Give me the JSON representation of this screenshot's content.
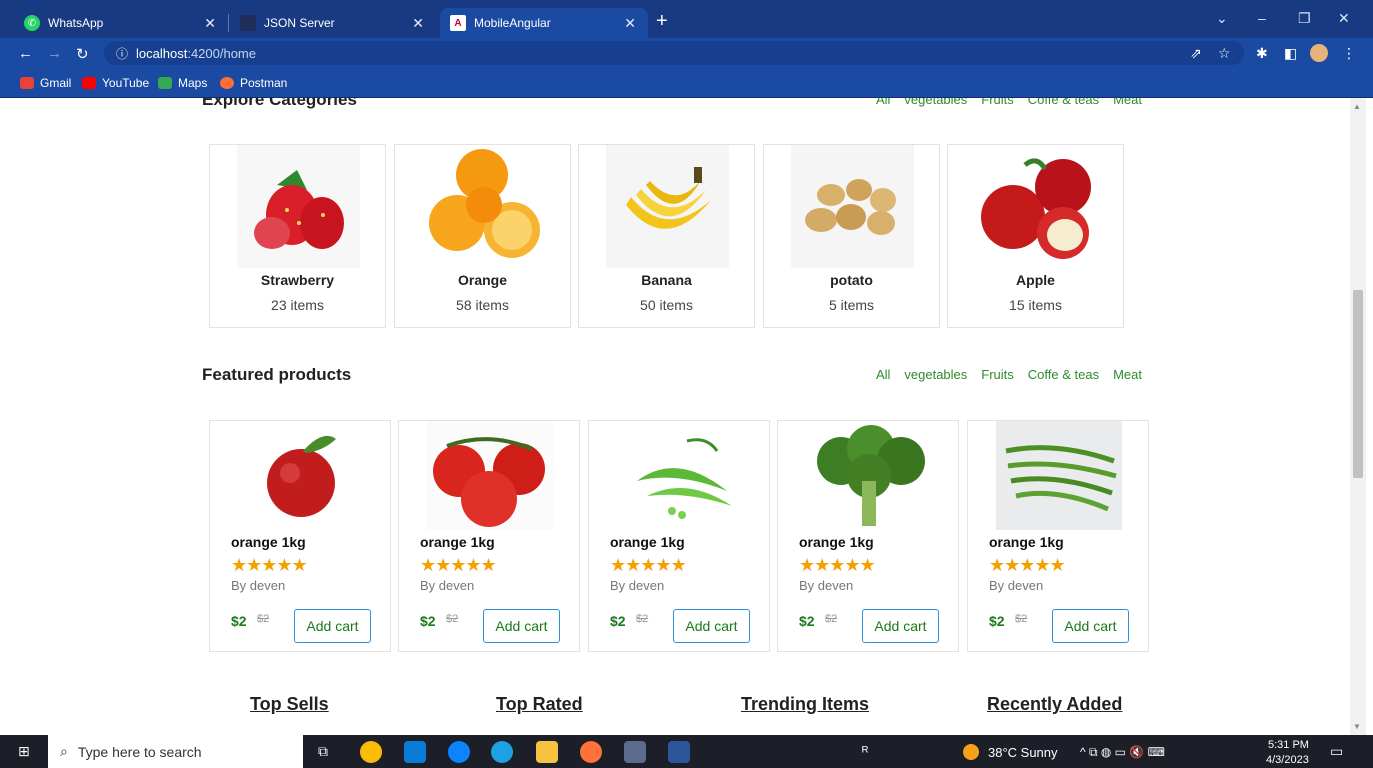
{
  "browser": {
    "tabs": [
      {
        "title": "WhatsApp",
        "active": false
      },
      {
        "title": "JSON Server",
        "active": false
      },
      {
        "title": "MobileAngular",
        "active": true
      }
    ],
    "url_host": "localhost",
    "url_rest": ":4200/home",
    "bookmarks": [
      {
        "label": "Gmail",
        "color": "#ea4335"
      },
      {
        "label": "YouTube",
        "color": "#ff0000"
      },
      {
        "label": "Maps",
        "color": "#34a853"
      },
      {
        "label": "Postman",
        "color": "#ff6c37"
      }
    ]
  },
  "categories_section": {
    "title": "Explore Categories",
    "filters": [
      "All",
      "vegetables",
      "Fruits",
      "Coffe & teas",
      "Meat"
    ],
    "items": [
      {
        "name": "Strawberry",
        "count": "23 items",
        "icon": "strawberry-icon"
      },
      {
        "name": "Orange",
        "count": "58 items",
        "icon": "orange-icon"
      },
      {
        "name": "Banana",
        "count": "50 items",
        "icon": "banana-icon"
      },
      {
        "name": "potato",
        "count": "5 items",
        "icon": "potato-icon"
      },
      {
        "name": "Apple",
        "count": "15 items",
        "icon": "apple-icon"
      }
    ]
  },
  "featured_section": {
    "title": "Featured products",
    "filters": [
      "All",
      "vegetables",
      "Fruits",
      "Coffe & teas",
      "Meat"
    ],
    "products": [
      {
        "name": "orange 1kg",
        "by": "By deven",
        "price": "$2",
        "old_price": "$2",
        "button": "Add cart",
        "stars": "★★★★★",
        "icon": "apple-icon"
      },
      {
        "name": "orange 1kg",
        "by": "By deven",
        "price": "$2",
        "old_price": "$2",
        "button": "Add cart",
        "stars": "★★★★★",
        "icon": "tomato-icon"
      },
      {
        "name": "orange 1kg",
        "by": "By deven",
        "price": "$2",
        "old_price": "$2",
        "button": "Add cart",
        "stars": "★★★★★",
        "icon": "peas-icon"
      },
      {
        "name": "orange 1kg",
        "by": "By deven",
        "price": "$2",
        "old_price": "$2",
        "button": "Add cart",
        "stars": "★★★★★",
        "icon": "broccoli-icon"
      },
      {
        "name": "orange 1kg",
        "by": "By deven",
        "price": "$2",
        "old_price": "$2",
        "button": "Add cart",
        "stars": "★★★★★",
        "icon": "beans-icon"
      }
    ]
  },
  "bottom_links": [
    "Top Sells",
    "Top Rated",
    "Trending Items",
    "Recently Added"
  ],
  "taskbar": {
    "search_placeholder": "Type here to search",
    "weather": "38°C  Sunny",
    "time": "5:31 PM",
    "date": "4/3/2023"
  }
}
